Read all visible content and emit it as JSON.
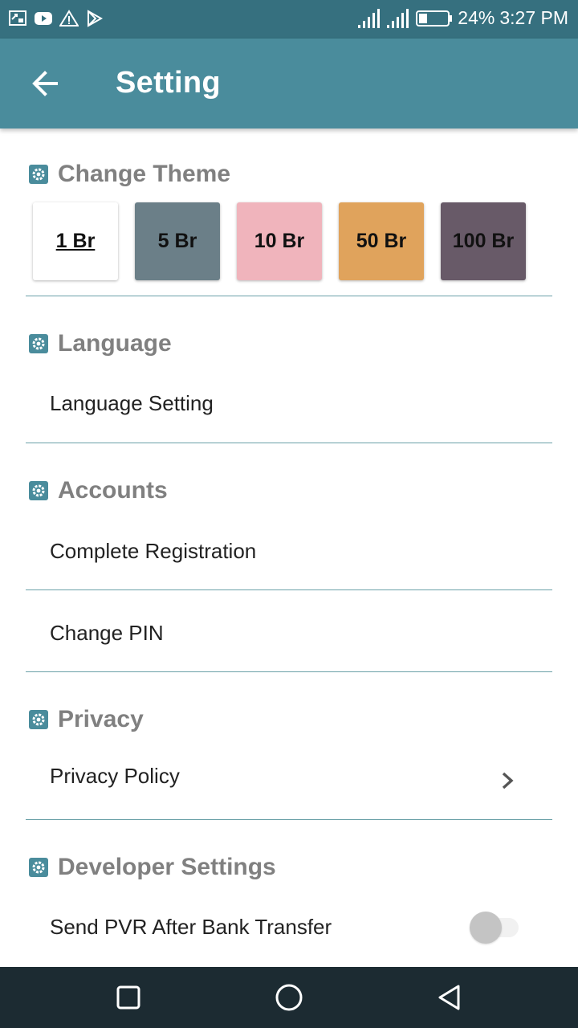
{
  "status_bar": {
    "battery": "24%",
    "time": "3:27 PM",
    "left_icons": [
      "screen-cast-icon",
      "youtube-icon",
      "warning-icon",
      "play-store-icon"
    ],
    "right_icons": [
      "signal-icon",
      "signal-icon",
      "battery-icon"
    ]
  },
  "app_bar": {
    "title": "Setting",
    "back_icon": "arrow-left-icon"
  },
  "sections": {
    "theme": {
      "title": "Change Theme",
      "icon": "gear-icon",
      "options": [
        {
          "label": "1 Br",
          "color": "#ffffff",
          "selected": true
        },
        {
          "label": "5 Br",
          "color": "#6b7f88",
          "selected": false
        },
        {
          "label": "10 Br",
          "color": "#f0b4bc",
          "selected": false
        },
        {
          "label": "50 Br",
          "color": "#e0a35c",
          "selected": false
        },
        {
          "label": "100 Br",
          "color": "#685a68",
          "selected": false
        }
      ]
    },
    "language": {
      "title": "Language",
      "icon": "gear-icon",
      "items": [
        "Language Setting"
      ]
    },
    "accounts": {
      "title": "Accounts",
      "icon": "gear-icon",
      "items": [
        "Complete Registration",
        "Change PIN"
      ]
    },
    "privacy": {
      "title": "Privacy",
      "icon": "gear-icon",
      "items": [
        "Privacy Policy"
      ]
    },
    "developer": {
      "title": "Developer Settings",
      "icon": "gear-icon",
      "items": [
        "Send PVR After Bank Transfer"
      ],
      "toggle_on": false
    }
  },
  "nav_bar": {
    "icons": [
      "recents-icon",
      "home-icon",
      "back-triangle-icon"
    ]
  },
  "colors": {
    "status_bar": "#36707f",
    "app_bar": "#4a8c9c",
    "section_icon": "#4a8c9c",
    "section_title": "#808080",
    "divider": "#6aa0a8",
    "nav_bar": "#1c2b32"
  }
}
